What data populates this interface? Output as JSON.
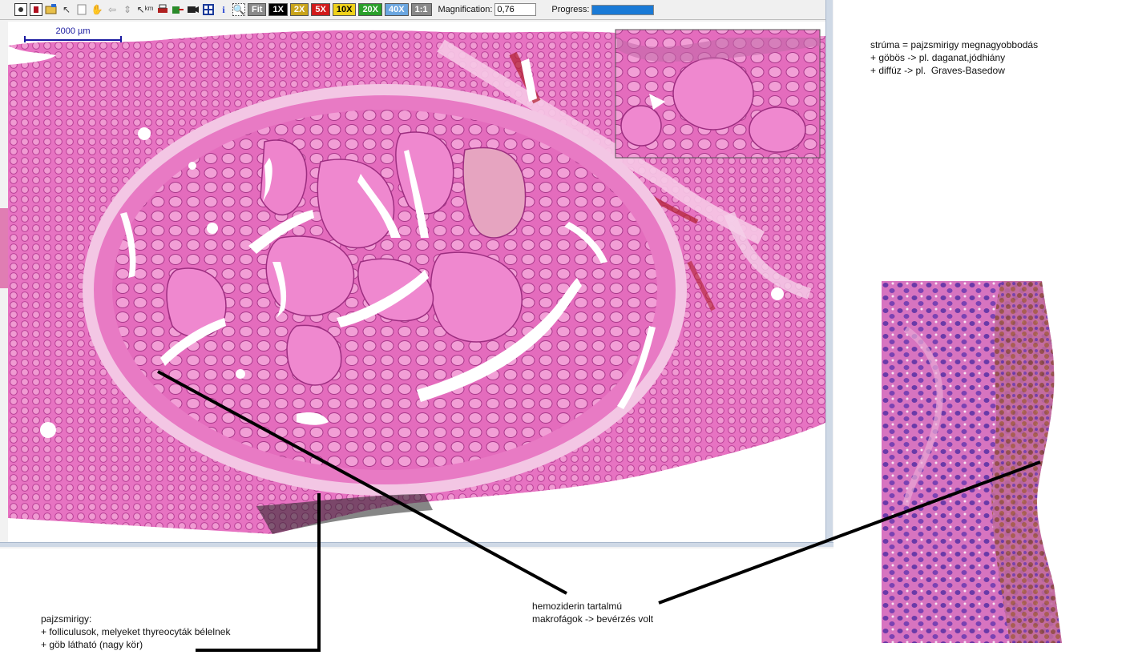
{
  "toolbar": {
    "icons": [
      "slide-icon",
      "slide-red-icon",
      "folder-icon",
      "pointer-icon",
      "page-icon",
      "hand-icon",
      "arrow-icon",
      "tool-icon",
      "measure-icon",
      "print-icon",
      "export-icon",
      "camera-icon",
      "grid-icon",
      "info-icon",
      "zoom-icon"
    ],
    "zoom_buttons": [
      {
        "label": "Fit",
        "bg": "#8a8a8a",
        "fg": "#ffffff"
      },
      {
        "label": "1X",
        "bg": "#000000",
        "fg": "#ffffff"
      },
      {
        "label": "2X",
        "bg": "#c9a41a",
        "fg": "#ffffff"
      },
      {
        "label": "5X",
        "bg": "#d11a1a",
        "fg": "#ffffff"
      },
      {
        "label": "10X",
        "bg": "#f0d21a",
        "fg": "#000000"
      },
      {
        "label": "20X",
        "bg": "#2aa02a",
        "fg": "#ffffff"
      },
      {
        "label": "40X",
        "bg": "#6aa6e0",
        "fg": "#ffffff"
      },
      {
        "label": "1:1",
        "bg": "#888888",
        "fg": "#ffffff"
      }
    ],
    "magnification_label": "Magnification:",
    "magnification_value": "0,76",
    "progress_label": "Progress:",
    "progress_fraction": 1.0
  },
  "scalebar": {
    "label": "2000 µm"
  },
  "annotations": {
    "struma": "strúma = pajzsmirigy megnagyobbodás\n+ göbös -> pl. daganat,jódhiány\n+ diffúz -> pl.  Graves-Basedow",
    "thyroid": "pajzsmirigy:\n+ folliculusok, melyeket thyreocyták bélelnek\n+ göb látható (nagy kör)",
    "hemosiderin": "hemoziderin tartalmú\nmakrofágok -> bevérzés volt"
  },
  "colors": {
    "tissue": "#e870c0",
    "tissue_dark": "#d84aa8",
    "colloid": "#f2a0d4",
    "stroma": "#c8409a",
    "blood": "#b8202a",
    "accent": "#1a7ad6"
  }
}
